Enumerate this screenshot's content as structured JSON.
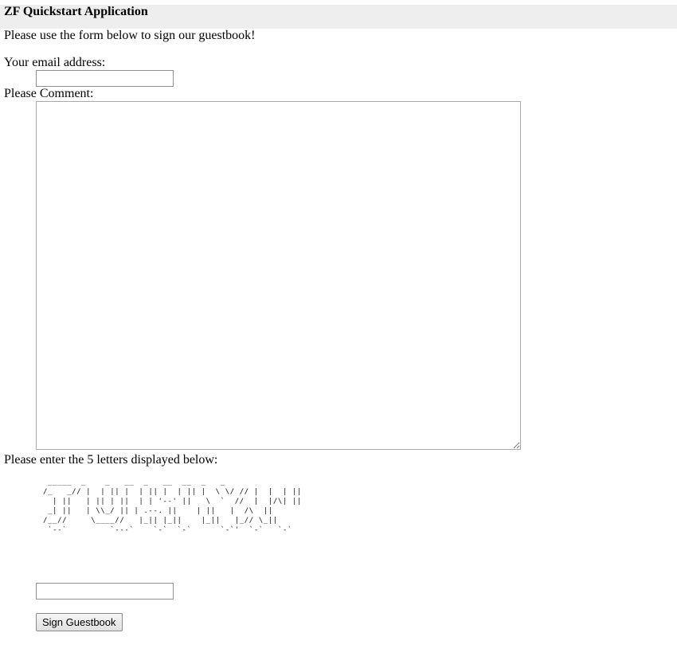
{
  "header": {
    "title": "ZF Quickstart Application"
  },
  "form": {
    "intro": "Please use the form below to sign our guestbook!",
    "email_label": "Your email address:",
    "email_value": "",
    "comment_label": "Please Comment:",
    "comment_value": "",
    "captcha_label": "Please enter the 5 letters displayed below:",
    "captcha_art": "  _____  _    _   __  _   __  __  _   _\n /_   _// |  | || |  | || |  | || |  \\ \\/ // |  |  | ||\n   | ||   | || | ||  | | '--' ||   \\  `  //  |  |/\\| ||\n  _| ||   | \\\\_/ || | .--. ||    | ||   |  /\\  ||\n /__//     \\____//   |_|| |_||    |_||   |_// \\_||\n  `--`         `---`    `-`  `-`      `-`'  `-`   `-`",
    "captcha_value": "",
    "submit_label": "Sign Guestbook"
  }
}
